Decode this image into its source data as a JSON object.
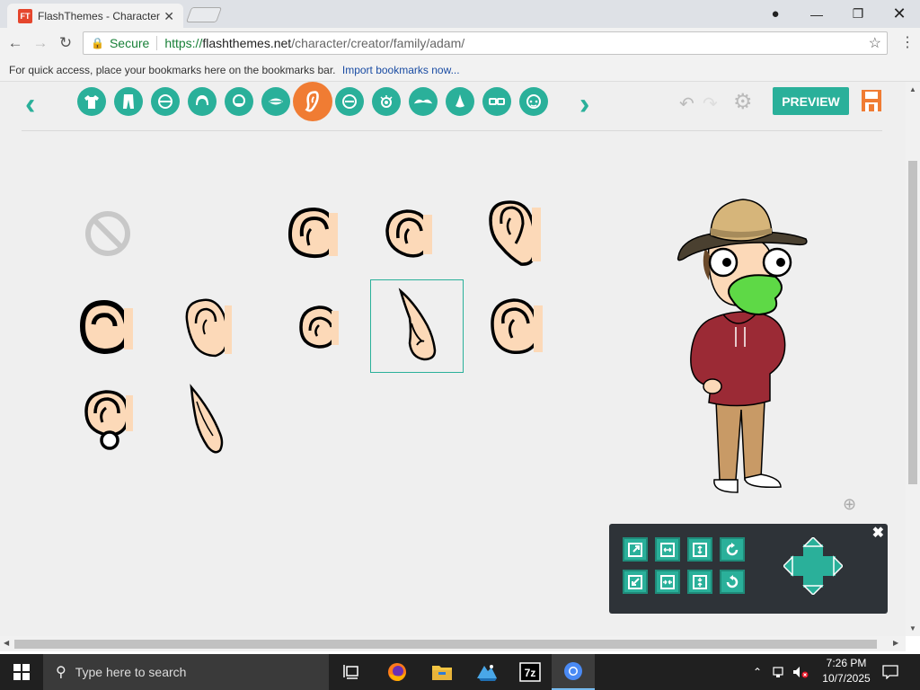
{
  "browser": {
    "tab_title": "FlashThemes - Character",
    "favicon_text": "FT",
    "security_label": "Secure",
    "url_scheme": "https://",
    "url_host": "flashthemes.net",
    "url_path": "/character/creator/family/adam/",
    "bookmarks_hint": "For quick access, place your bookmarks here on the bookmarks bar.",
    "import_link": "Import bookmarks now..."
  },
  "editor": {
    "preview_label": "PREVIEW",
    "categories": [
      "shirt-icon",
      "pants-icon",
      "face-shape-icon",
      "hair-icon",
      "beard-icon",
      "mouth-icon",
      "ear-icon",
      "eye-shape-icon",
      "eye-icon",
      "eyebrow-icon",
      "nose-icon",
      "glasses-icon",
      "accessory-icon"
    ],
    "active_category": "ear-icon",
    "ear_options_count": 12,
    "selected_option": "elf-ear-2"
  },
  "taskbar": {
    "search_placeholder": "Type here to search",
    "time": "7:26 PM",
    "date": "10/7/2025"
  },
  "colors": {
    "accent": "#2ab09a",
    "active": "#f07c33",
    "skin": "#fcd9b8"
  }
}
